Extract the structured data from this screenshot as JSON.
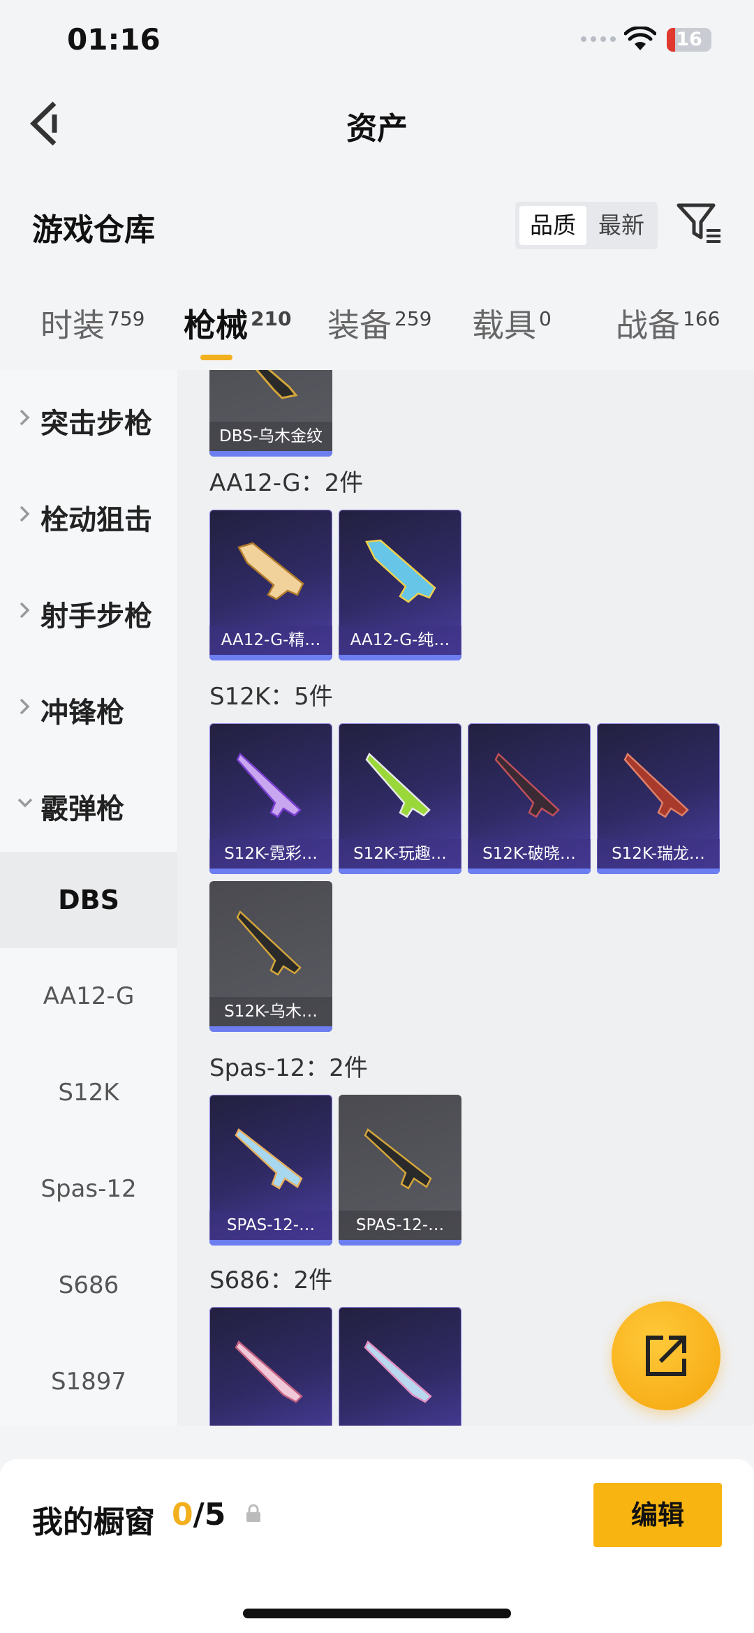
{
  "status": {
    "time": "01:16",
    "battery": "16"
  },
  "header": {
    "title": "资产"
  },
  "warehouse": {
    "title": "游戏仓库",
    "sort": [
      "品质",
      "最新"
    ]
  },
  "tabs": [
    {
      "label": "时装",
      "count": "759"
    },
    {
      "label": "枪械",
      "count": "210"
    },
    {
      "label": "装备",
      "count": "259"
    },
    {
      "label": "载具",
      "count": "0"
    },
    {
      "label": "战备",
      "count": "166"
    }
  ],
  "sidebar": {
    "categories": [
      "突击步枪",
      "栓动狙击",
      "射手步枪",
      "冲锋枪",
      "霰弹枪"
    ],
    "subitems": [
      "DBS",
      "AA12-G",
      "S12K",
      "Spas-12",
      "S686",
      "S1897"
    ]
  },
  "groups": {
    "dbs": {
      "items": [
        "DBS-乌木金纹"
      ]
    },
    "aa12": {
      "title": "AA12-G：2件",
      "items": [
        "AA12-G-精…",
        "AA12-G-纯…"
      ]
    },
    "s12k": {
      "title": "S12K：5件",
      "items": [
        "S12K-霓彩…",
        "S12K-玩趣…",
        "S12K-破晓…",
        "S12K-瑞龙…",
        "S12K-乌木…"
      ]
    },
    "spas": {
      "title": "Spas-12：2件",
      "items": [
        "SPAS-12-…",
        "SPAS-12-…"
      ]
    },
    "s686": {
      "title": "S686：2件"
    }
  },
  "showcase": {
    "title": "我的橱窗",
    "current": "0",
    "total": "/5",
    "edit": "编辑"
  },
  "colors": {
    "accent": "#f2b01e",
    "card_purple": "#2f2a63",
    "card_gray": "#55555c",
    "card_bar": "#6c7ef0"
  }
}
